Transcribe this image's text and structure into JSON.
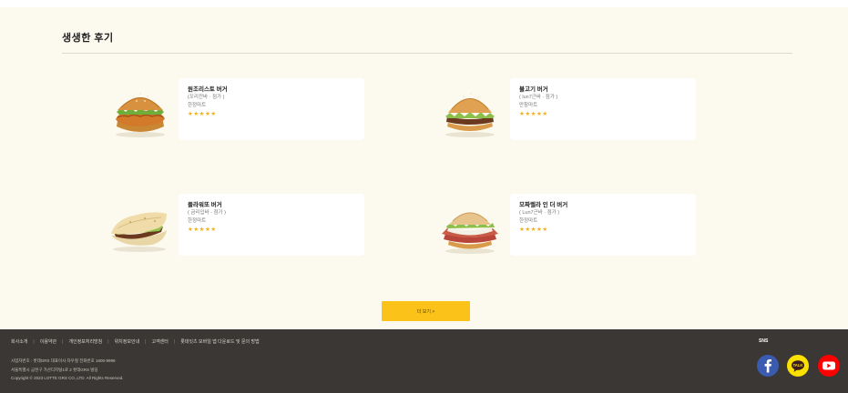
{
  "section": {
    "title": "생생한 후기"
  },
  "reviews": [
    {
      "name": "원조리스토 버거",
      "meta": "(꼬리칸바 · 점가 )",
      "author": "한정마트",
      "rating": 5,
      "stars": "★★★★★"
    },
    {
      "name": "불고기 버거",
      "meta": "( lun7근바 · 점가 )",
      "author": "만참마트",
      "rating": 5,
      "stars": "★★★★★"
    },
    {
      "name": "플라워또 버거",
      "meta": "( 금리입바 · 점가 )",
      "author": "한정마트",
      "rating": 5,
      "stars": "★★★★★"
    },
    {
      "name": "모짜렐라 인 더 버거",
      "meta": "( Lun7근바 · 점가 )",
      "author": "한정마트",
      "rating": 5,
      "stars": "★★★★★"
    }
  ],
  "more_button": {
    "label": "더 보기 >"
  },
  "footer": {
    "links": [
      "회사소개",
      "이용약관",
      "개인정보처리방침",
      "위치정보안내",
      "고객센터",
      "롯데잇츠 모바일 앱 다운로드 및 문의 방법"
    ],
    "info_lines": [
      "사업자번호 : 롯데GRS 대표이사 차우철 전화번호 1600-9999",
      "서울특별시 금천구 가산디지털1로 2 롯데GRS 빌딩",
      "Copyright © 2023 LOTTE GRS CO.,LTD. All Rights Reserved."
    ],
    "sns_label": "SNS",
    "sns": [
      {
        "name": "facebook",
        "icon": "facebook-icon",
        "color": "#3b5bb0"
      },
      {
        "name": "kakaotalk",
        "icon": "kakao-talk-icon",
        "color": "#fae100"
      },
      {
        "name": "youtube",
        "icon": "youtube-icon",
        "color": "#ff0000"
      }
    ]
  },
  "colors": {
    "content_background": "#fcf9ee",
    "accent": "#fbc21a",
    "star": "#f2b11b",
    "footer_background": "#3a3734"
  }
}
